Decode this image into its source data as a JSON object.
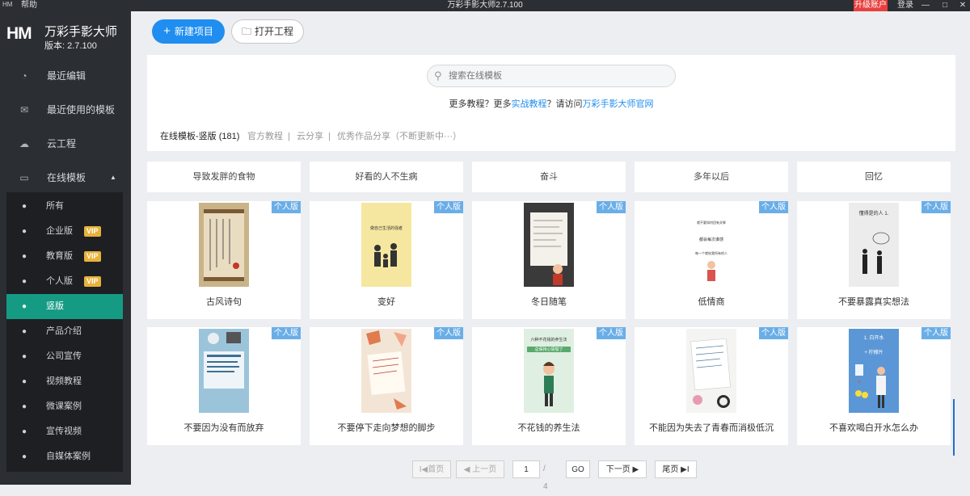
{
  "titlebar": {
    "app_icon": "HM",
    "help": "帮助",
    "title": "万彩手影大师2.7.100",
    "upgrade": "升级账户",
    "login": "登录",
    "minimize": "—",
    "maximize": "□",
    "close": "✕"
  },
  "sidebar": {
    "logo": "HM",
    "app_name": "万彩手影大师",
    "version": "版本: 2.7.100",
    "nav": [
      {
        "label": "最近编辑",
        "icon": "pie-chart-icon"
      },
      {
        "label": "最近使用的模板",
        "icon": "mail-icon"
      },
      {
        "label": "云工程",
        "icon": "cloud-icon"
      },
      {
        "label": "在线模板",
        "icon": "monitor-icon"
      }
    ],
    "sub": [
      {
        "label": "所有",
        "vip": ""
      },
      {
        "label": "企业版",
        "vip": "VIP"
      },
      {
        "label": "教育版",
        "vip": "VIP"
      },
      {
        "label": "个人版",
        "vip": "VIP"
      },
      {
        "label": "竖版",
        "vip": ""
      },
      {
        "label": "产品介绍",
        "vip": ""
      },
      {
        "label": "公司宣传",
        "vip": ""
      },
      {
        "label": "视频教程",
        "vip": ""
      },
      {
        "label": "微课案例",
        "vip": ""
      },
      {
        "label": "宣传视频",
        "vip": ""
      },
      {
        "label": "自媒体案例",
        "vip": ""
      }
    ]
  },
  "toolbar": {
    "new_label": "新建项目",
    "open_label": "打开工程"
  },
  "search": {
    "placeholder": "搜索在线模板",
    "more_prefix": "更多教程？更多",
    "more_link1": "实战教程",
    "more_mid": "？请访问",
    "more_link2": "万彩手影大师官网"
  },
  "tabs": {
    "active": "在线模板-竖版 (181)",
    "t2": "官方教程",
    "t3": "云分享",
    "t4": "优秀作品分享（不断更新中···）",
    "sep": "|"
  },
  "categories": [
    "导致发胖的食物",
    "好看的人不生病",
    "奋斗",
    "多年以后",
    "回忆"
  ],
  "cards": [
    {
      "title": "古风诗句",
      "badge": "个人版",
      "thumb": "poem"
    },
    {
      "title": "变好",
      "badge": "个人版",
      "thumb": "family"
    },
    {
      "title": "冬日随笔",
      "badge": "个人版",
      "thumb": "notebook"
    },
    {
      "title": "低情商",
      "badge": "个人版",
      "thumb": "girl"
    },
    {
      "title": "不要暴露真实想法",
      "badge": "个人版",
      "thumb": "people"
    },
    {
      "title": "不要因为没有而放弃",
      "badge": "个人版",
      "thumb": "desk"
    },
    {
      "title": "不要停下走向梦想的脚步",
      "badge": "个人版",
      "thumb": "leaves"
    },
    {
      "title": "不花钱的养生法",
      "badge": "个人版",
      "thumb": "green"
    },
    {
      "title": "不能因为失去了青春而消极低沉",
      "badge": "个人版",
      "thumb": "flowers"
    },
    {
      "title": "不喜欢喝白开水怎么办",
      "badge": "个人版",
      "thumb": "blue"
    }
  ],
  "thumb_text": {
    "family": "做自己生活的强者",
    "girl1": "就不要如何回有文辉",
    "girl2": "都会每次谁感",
    "girl3": "每一个就给我所有的人",
    "people": "懂得是的人 1.",
    "green1": "六种不花钱的养生法",
    "green2": "总保持心情愉了",
    "blue1": "1. 白开水",
    "blue2": "+ 柠檬片"
  },
  "pager": {
    "first": "I◀首页",
    "prev": "◀ 上一页",
    "current": "1",
    "total": "/ 4",
    "go": "GO",
    "next": "下一页 ▶",
    "last": "尾页 ▶I"
  },
  "colors": {
    "sidebar": "#2b2e33",
    "accent": "#1f8ef0",
    "active": "#159b83",
    "badge": "#6aaee8",
    "vip": "#e8b23b",
    "upgrade": "#e8403f"
  }
}
